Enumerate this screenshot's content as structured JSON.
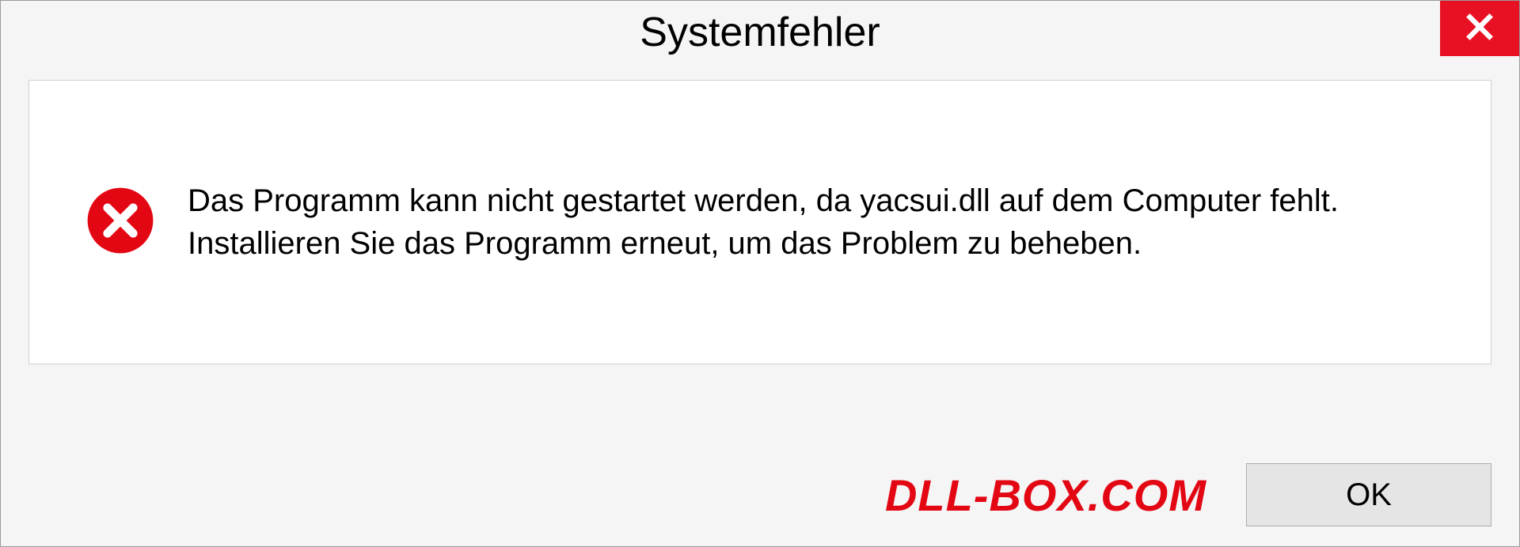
{
  "dialog": {
    "title": "Systemfehler",
    "message": "Das Programm kann nicht gestartet werden, da yacsui.dll auf dem Computer fehlt. Installieren Sie das Programm erneut, um das Problem zu beheben.",
    "ok_label": "OK"
  },
  "watermark": "DLL-BOX.COM"
}
